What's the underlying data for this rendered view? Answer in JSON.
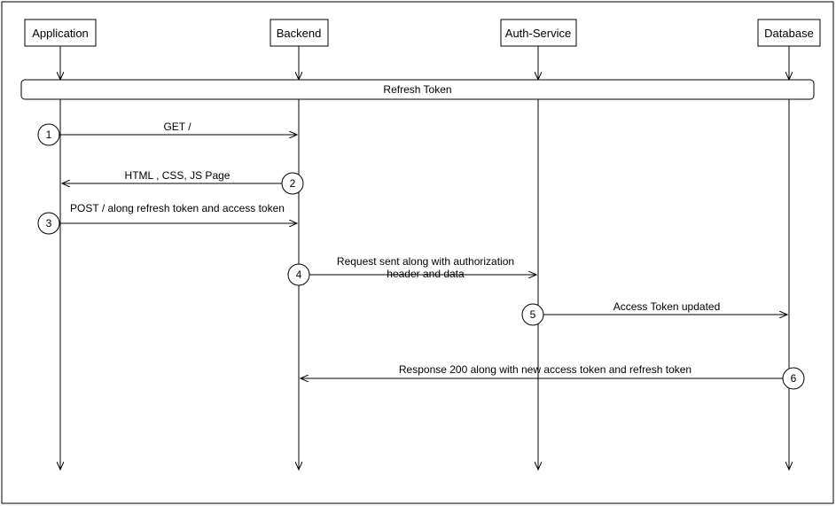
{
  "actors": {
    "application": "Application",
    "backend": "Backend",
    "authservice": "Auth-Service",
    "database": "Database"
  },
  "frame": {
    "title": "Refresh Token"
  },
  "messages": {
    "m1": "GET /",
    "m2": "HTML , CSS, JS Page",
    "m3": "POST / along refresh token and access token",
    "m4a": "Request sent along with authorization",
    "m4b": "header and data",
    "m5": "Access Token updated",
    "m6": "Response 200 along with new access token and refresh token"
  },
  "steps": {
    "s1": "1",
    "s2": "2",
    "s3": "3",
    "s4": "4",
    "s5": "5",
    "s6": "6"
  }
}
